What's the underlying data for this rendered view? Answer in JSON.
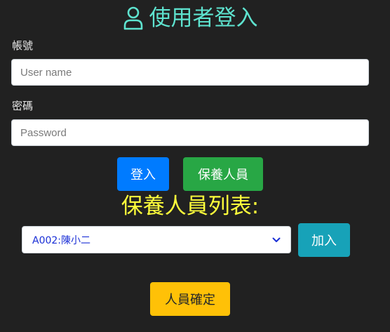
{
  "header": {
    "icon": "user-icon",
    "title": "使用者登入",
    "color": "#5ee3cf"
  },
  "login_form": {
    "username_label": "帳號",
    "username_placeholder": "User name",
    "username_value": "",
    "password_label": "密碼",
    "password_placeholder": "Password",
    "password_value": ""
  },
  "buttons": {
    "login_label": "登入",
    "login_color": "#007bff",
    "caretaker_label": "保養人員",
    "caretaker_color": "#28a745",
    "add_label": "加入",
    "add_color": "#17a2b8",
    "confirm_label": "人員確定",
    "confirm_color": "#ffc107"
  },
  "caretaker_list": {
    "title": "保養人員列表:",
    "title_color": "#ffff3b",
    "selected_option": "A002:陳小二",
    "dropdown_icon": "chevron-down-icon"
  }
}
